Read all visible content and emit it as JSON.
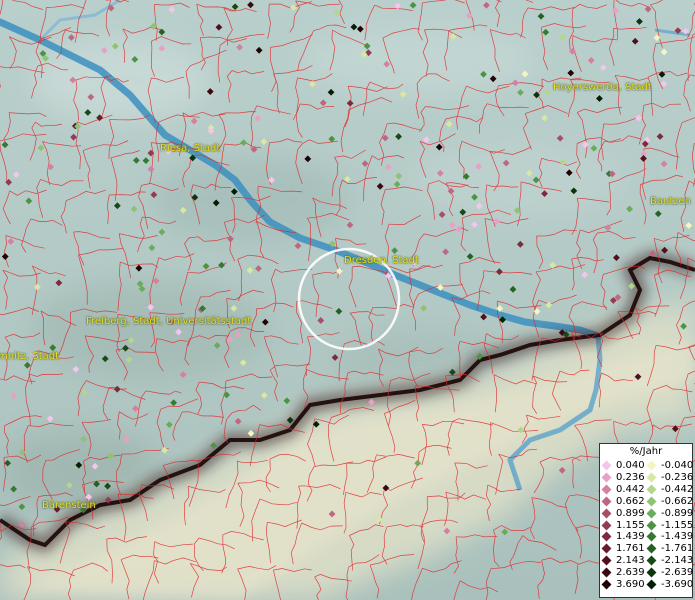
{
  "places": [
    {
      "name": "Hoyerswerda, Stadt",
      "id": "hoyerswerda"
    },
    {
      "name": "Riesa, Stadt",
      "id": "riesa"
    },
    {
      "name": "Bautzen",
      "id": "bautzen"
    },
    {
      "name": "Dresden, Stadt",
      "id": "dresden"
    },
    {
      "name": "Freiberg, Stadt, Universitätsstadt",
      "id": "freiberg"
    },
    {
      "name": "mnitz, Stadt",
      "id": "chemnitz"
    },
    {
      "name": "Bärenstein",
      "id": "baerenstein"
    }
  ],
  "legend": {
    "title": "%/Jahr",
    "positive": [
      {
        "value": "0.040",
        "color": "#f4c6ec"
      },
      {
        "value": "0.236",
        "color": "#e8a0c4"
      },
      {
        "value": "0.442",
        "color": "#d4809e"
      },
      {
        "value": "0.662",
        "color": "#bf6682"
      },
      {
        "value": "0.899",
        "color": "#a84e68"
      },
      {
        "value": "1.155",
        "color": "#933b52"
      },
      {
        "value": "1.439",
        "color": "#7c2a3e"
      },
      {
        "value": "1.761",
        "color": "#651c2c"
      },
      {
        "value": "2.143",
        "color": "#4e111d"
      },
      {
        "value": "2.639",
        "color": "#380910"
      },
      {
        "value": "3.690",
        "color": "#200305"
      }
    ],
    "negative": [
      {
        "value": "-0.040",
        "color": "#f2f6c2"
      },
      {
        "value": "-0.236",
        "color": "#d6e8a2"
      },
      {
        "value": "-0.442",
        "color": "#b4d68a"
      },
      {
        "value": "-0.662",
        "color": "#8fc272"
      },
      {
        "value": "-0.899",
        "color": "#6aac5a"
      },
      {
        "value": "-1.155",
        "color": "#4c9444"
      },
      {
        "value": "-1.439",
        "color": "#357a32"
      },
      {
        "value": "-1.761",
        "color": "#246224"
      },
      {
        "value": "-2.143",
        "color": "#164a17"
      },
      {
        "value": "-2.639",
        "color": "#0b330c"
      },
      {
        "value": "-3.690",
        "color": "#041e05"
      }
    ]
  }
}
